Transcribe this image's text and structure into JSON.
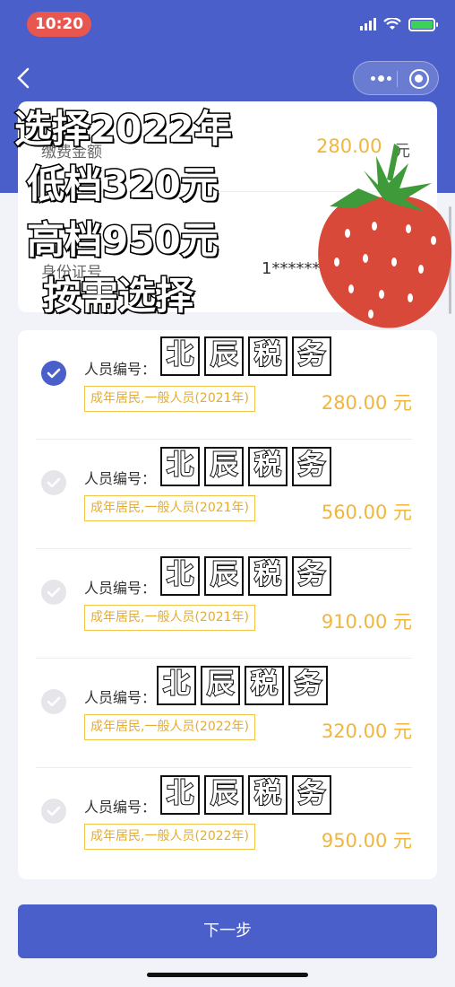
{
  "status_bar": {
    "time": "10:20"
  },
  "payment_info": {
    "amount_label": "缴费金额",
    "amount_value": "280.00",
    "amount_unit": "元",
    "id_label": "身份证号",
    "id_value": "1********"
  },
  "overlay": {
    "line1": "选择2022年",
    "line2": "低档320元",
    "line3": "高档950元",
    "line4": "按需选择"
  },
  "stamp_chars": [
    "北",
    "辰",
    "税",
    "务"
  ],
  "items": [
    {
      "pid_label": "人员编号：",
      "tag": "成年居民,一般人员(2021年)",
      "amount": "280.00",
      "unit": "元",
      "selected": true
    },
    {
      "pid_label": "人员编号：",
      "tag": "成年居民,一般人员(2021年)",
      "amount": "560.00",
      "unit": "元",
      "selected": false
    },
    {
      "pid_label": "人员编号：",
      "tag": "成年居民,一般人员(2021年)",
      "amount": "910.00",
      "unit": "元",
      "selected": false
    },
    {
      "pid_label": "人员编号：",
      "tag": "成年居民,一般人员(2022年)",
      "amount": "320.00",
      "unit": "元",
      "selected": false
    },
    {
      "pid_label": "人员编号：",
      "tag": "成年居民,一般人员(2022年)",
      "amount": "950.00",
      "unit": "元",
      "selected": false
    }
  ],
  "next_button": "下一步",
  "colors": {
    "primary": "#4a5fc9",
    "amount": "#f0b63d",
    "time_pill": "#e8574f"
  }
}
